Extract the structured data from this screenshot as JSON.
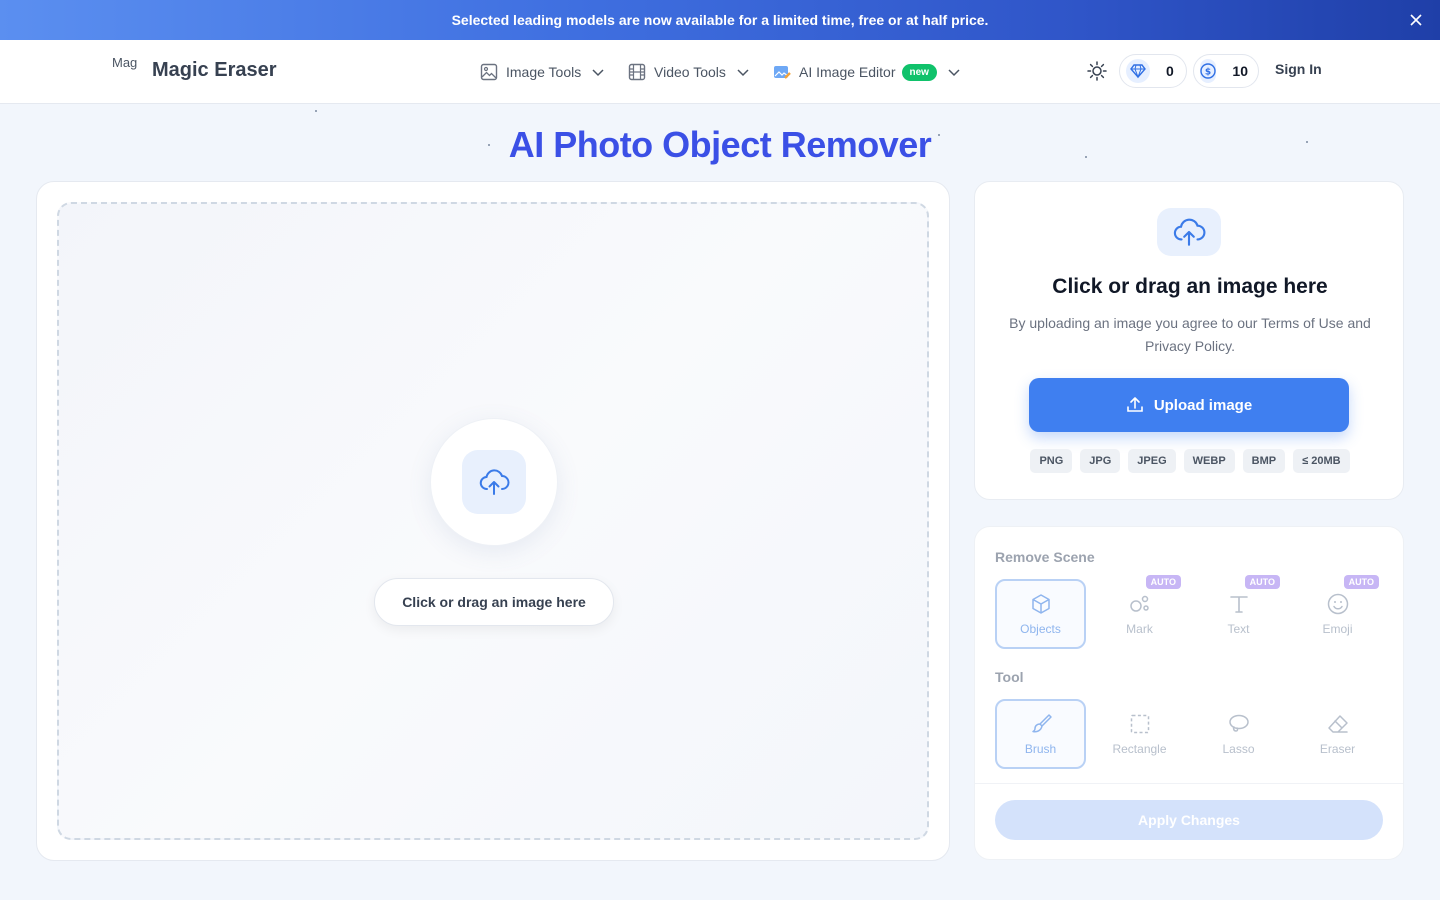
{
  "banner": {
    "text": "Selected leading models are now available for a limited time, free or at half price."
  },
  "header": {
    "logo_alt": "Mag",
    "logo_text": "Magic Eraser",
    "nav": {
      "image_tools": "Image Tools",
      "video_tools": "Video Tools",
      "ai_image_editor": "AI Image Editor",
      "new_badge": "new"
    },
    "gems": "0",
    "coins": "10",
    "sign_in": "Sign In"
  },
  "page": {
    "title": "AI Photo Object Remover"
  },
  "dropzone": {
    "button_label": "Click or drag an image here"
  },
  "upload": {
    "title": "Click or drag an image here",
    "description": "By uploading an image you agree to our Terms of Use and Privacy Policy.",
    "button_label": "Upload image",
    "formats": [
      "PNG",
      "JPG",
      "JPEG",
      "WEBP",
      "BMP",
      "≤ 20MB"
    ]
  },
  "tools": {
    "remove_scene_title": "Remove Scene",
    "scene_options": {
      "objects": "Objects",
      "mark": "Mark",
      "text": "Text",
      "emoji": "Emoji",
      "auto_badge": "AUTO"
    },
    "tool_title": "Tool",
    "tool_options": {
      "brush": "Brush",
      "rectangle": "Rectangle",
      "lasso": "Lasso",
      "eraser": "Eraser"
    },
    "apply_label": "Apply Changes"
  }
}
